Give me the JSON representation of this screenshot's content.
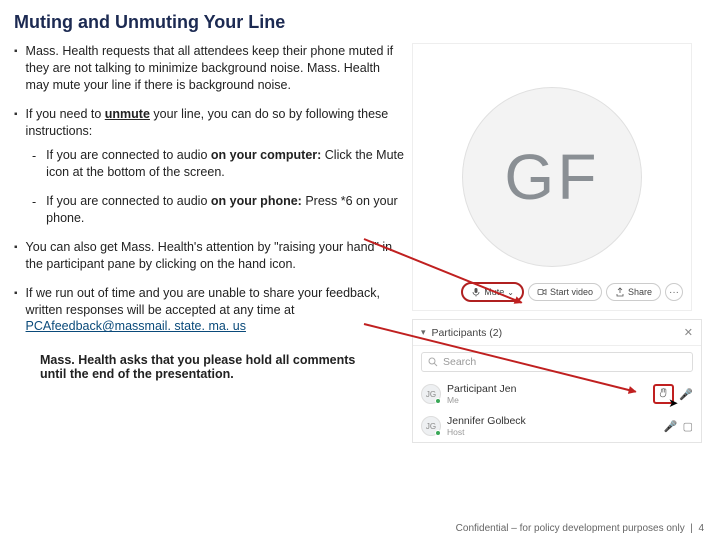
{
  "title": "Muting and Unmuting Your Line",
  "bullets": {
    "b1": "Mass. Health requests that all attendees keep their phone muted if they are not talking to minimize background noise. Mass. Health may mute your line if there is background noise.",
    "b2_pre": "If you need to ",
    "b2_u": "unmute",
    "b2_post": " your line, you can do so by following these instructions:",
    "s1_pre": "If you are connected to audio ",
    "s1_b": "on your computer:",
    "s1_post": " Click the Mute icon at the bottom of the screen.",
    "s2_pre": "If you are connected to audio ",
    "s2_b": "on your phone:",
    "s2_post": " Press *6 on your phone.",
    "b3": "You can also get Mass. Health's attention by \"raising your hand\" in the participant pane by clicking on the hand icon.",
    "b4_pre": "If we run out of time and you are unable to share your feedback, written responses will be accepted at any time at ",
    "b4_mail": "PCAfeedback@massmail. state. ma. us"
  },
  "closing": "Mass. Health asks that you please hold all comments until the end of the presentation.",
  "footer": {
    "text": "Confidential – for policy development purposes only",
    "sep": "|",
    "page": "4"
  },
  "avatar": {
    "initials": "GF"
  },
  "toolbar": {
    "mute": "Mute",
    "video": "Start video",
    "share": "Share",
    "more": "···"
  },
  "participants": {
    "header": "Participants (2)",
    "search": "Search",
    "rows": [
      {
        "initials": "JG",
        "name": "Participant Jen",
        "sub": "Me"
      },
      {
        "initials": "JG",
        "name": "Jennifer Golbeck",
        "sub": "Host"
      }
    ]
  }
}
